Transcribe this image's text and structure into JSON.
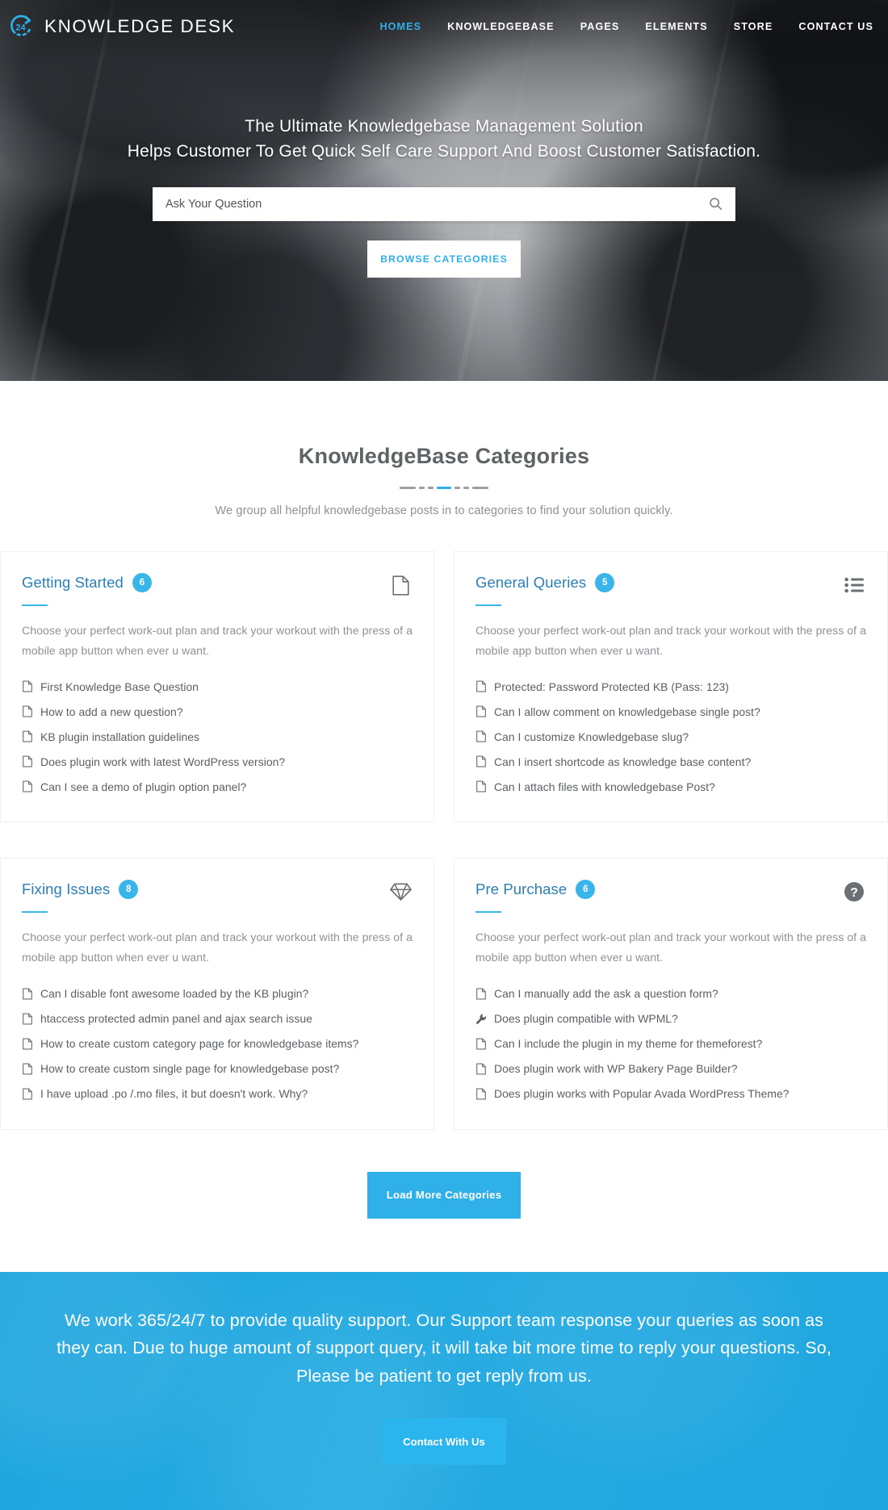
{
  "header": {
    "logo_icon": "clock-24-icon",
    "brand": "KNOWLEDGE DESK",
    "nav": [
      {
        "label": "HOMES",
        "active": true
      },
      {
        "label": "KNOWLEDGEBASE",
        "active": false
      },
      {
        "label": "PAGES",
        "active": false
      },
      {
        "label": "ELEMENTS",
        "active": false
      },
      {
        "label": "STORE",
        "active": false
      },
      {
        "label": "CONTACT US",
        "active": false
      }
    ]
  },
  "hero": {
    "title_line1": "The Ultimate Knowledgebase Management Solution",
    "title_line2": "Helps Customer To Get Quick Self Care Support And Boost Customer Satisfaction.",
    "search_placeholder": "Ask Your Question",
    "search_value": "",
    "search_icon": "search-icon",
    "browse_button": "BROWSE CATEGORIES"
  },
  "categories_section": {
    "title": "KnowledgeBase Categories",
    "subtitle": "We group all helpful knowledgebase posts in to categories to find your solution quickly.",
    "accent_color": "#2fb0e8",
    "load_more": "Load More Categories",
    "cards": [
      {
        "title": "Getting Started",
        "count": "6",
        "icon": "file-document-icon",
        "description": "Choose your perfect work-out plan and track your workout with the press of a mobile app button when ever u want.",
        "items": [
          {
            "icon": "file-document-icon",
            "label": "First Knowledge Base Question"
          },
          {
            "icon": "file-document-icon",
            "label": "How to add a new question?"
          },
          {
            "icon": "file-document-icon",
            "label": "KB plugin installation guidelines"
          },
          {
            "icon": "file-document-icon",
            "label": "Does plugin work with latest WordPress version?"
          },
          {
            "icon": "file-document-icon",
            "label": "Can I see a demo of plugin option panel?"
          }
        ]
      },
      {
        "title": "General Queries",
        "count": "5",
        "icon": "bulleted-list-icon",
        "description": "Choose your perfect work-out plan and track your workout with the press of a mobile app button when ever u want.",
        "items": [
          {
            "icon": "file-document-icon",
            "label": "Protected: Password Protected KB (Pass: 123)"
          },
          {
            "icon": "file-document-icon",
            "label": "Can I allow comment on knowledgebase single post?"
          },
          {
            "icon": "file-document-icon",
            "label": "Can I customize Knowledgebase slug?"
          },
          {
            "icon": "file-document-icon",
            "label": "Can I insert shortcode as knowledge base content?"
          },
          {
            "icon": "file-document-icon",
            "label": "Can I attach files with knowledgebase Post?"
          }
        ]
      },
      {
        "title": "Fixing Issues",
        "count": "8",
        "icon": "diamond-icon",
        "description": "Choose your perfect work-out plan and track your workout with the press of a mobile app button when ever u want.",
        "items": [
          {
            "icon": "file-document-icon",
            "label": "Can I disable font awesome loaded by the KB plugin?"
          },
          {
            "icon": "file-document-icon",
            "label": "htaccess protected admin panel and ajax search issue"
          },
          {
            "icon": "file-document-icon",
            "label": "How to create custom category page for knowledgebase items?"
          },
          {
            "icon": "file-document-icon",
            "label": "How to create custom single page for knowledgebase post?"
          },
          {
            "icon": "file-document-icon",
            "label": "I have upload .po /.mo files, it but doesn't work. Why?"
          }
        ]
      },
      {
        "title": "Pre Purchase",
        "count": "6",
        "icon": "question-circle-icon",
        "description": "Choose your perfect work-out plan and track your workout with the press of a mobile app button when ever u want.",
        "items": [
          {
            "icon": "file-document-icon",
            "label": "Can I manually add the ask a question form?"
          },
          {
            "icon": "wrench-icon",
            "label": "Does plugin compatible with WPML?"
          },
          {
            "icon": "file-document-icon",
            "label": "Can I include the plugin in my theme for themeforest?"
          },
          {
            "icon": "file-document-icon",
            "label": "Does plugin work with WP Bakery Page Builder?"
          },
          {
            "icon": "file-document-icon",
            "label": "Does plugin works with Popular Avada WordPress Theme?"
          }
        ]
      }
    ]
  },
  "cta": {
    "text": "We work 365/24/7 to provide quality support. Our Support team response your queries as soon as they can. Due to huge amount of support query, it will take bit more time to reply your questions. So, Please be patient to get reply from us.",
    "button": "Contact With Us",
    "background_color": "#22a9e0"
  }
}
